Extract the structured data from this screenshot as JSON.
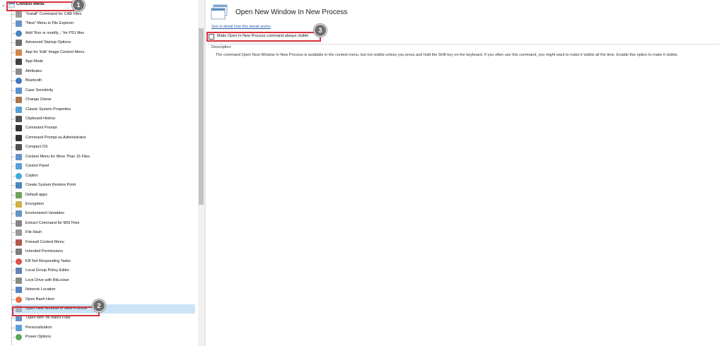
{
  "tree": {
    "root_label": "Context Menu",
    "items": [
      {
        "label": "\"Install\" Command for CAB Files",
        "icon": "cab-file-icon",
        "color": "#8a8a8a"
      },
      {
        "label": "\"New\" Menu in File Explorer",
        "icon": "new-menu-icon",
        "color": "#4a7fbf"
      },
      {
        "label": "Add 'Run or modify...' for PS1 files",
        "icon": "powershell-icon",
        "color": "#2b6cb8"
      },
      {
        "label": "Advanced Startup Options",
        "icon": "startup-icon",
        "color": "#555555"
      },
      {
        "label": "App for 'Edit' Image Context Menu",
        "icon": "paint-icon",
        "color": "#c9742d"
      },
      {
        "label": "App Mode",
        "icon": "app-mode-icon",
        "color": "#222222"
      },
      {
        "label": "Attributes",
        "icon": "attributes-icon",
        "color": "#7a7a7a"
      },
      {
        "label": "Bluetooth",
        "icon": "bluetooth-icon",
        "color": "#1f5fb5"
      },
      {
        "label": "Case Sensitivity",
        "icon": "case-sensitivity-icon",
        "color": "#3d7cc9"
      },
      {
        "label": "Change Owner",
        "icon": "owner-icon",
        "color": "#a05a2c"
      },
      {
        "label": "Classic System Properties",
        "icon": "system-properties-icon",
        "color": "#3a8fd0"
      },
      {
        "label": "Clipboard History",
        "icon": "clipboard-icon",
        "color": "#333333"
      },
      {
        "label": "Command Prompt",
        "icon": "command-prompt-icon",
        "color": "#111111"
      },
      {
        "label": "Command Prompt as Administrator",
        "icon": "admin-prompt-icon",
        "color": "#111111"
      },
      {
        "label": "Compact OS",
        "icon": "compact-os-icon",
        "color": "#333333"
      },
      {
        "label": "Context Menu for More Than 15 Files",
        "icon": "context-menu-icon",
        "color": "#4a7fbf"
      },
      {
        "label": "Control Panel",
        "icon": "control-panel-icon",
        "color": "#3f8dd6"
      },
      {
        "label": "Copilot",
        "icon": "copilot-icon",
        "color": "#1d9bd8"
      },
      {
        "label": "Create System Restore Point",
        "icon": "restore-point-icon",
        "color": "#2f6db5"
      },
      {
        "label": "Default apps",
        "icon": "default-apps-icon",
        "color": "#5a8f3c"
      },
      {
        "label": "Encryption",
        "icon": "lock-icon",
        "color": "#c9a227"
      },
      {
        "label": "Environment Variables",
        "icon": "environment-icon",
        "color": "#4d7fb8"
      },
      {
        "label": "Extract Command for MSI Files",
        "icon": "msi-file-icon",
        "color": "#6f6f6f"
      },
      {
        "label": "File Hash",
        "icon": "file-hash-icon",
        "color": "#888888"
      },
      {
        "label": "Firewall Context Menu",
        "icon": "firewall-icon",
        "color": "#a83a2a"
      },
      {
        "label": "Inherited Permissions",
        "icon": "permissions-icon",
        "color": "#666666"
      },
      {
        "label": "Kill Not Responding Tasks",
        "icon": "kill-task-icon",
        "color": "#d6332c"
      },
      {
        "label": "Local Group Policy Editor",
        "icon": "group-policy-icon",
        "color": "#4a6fa8"
      },
      {
        "label": "Lock Drive with BitLocker",
        "icon": "bitlocker-icon",
        "color": "#777777"
      },
      {
        "label": "Network Location",
        "icon": "network-icon",
        "color": "#3b6fb6"
      },
      {
        "label": "Open Bash Here",
        "icon": "ubuntu-icon",
        "color": "#e95420"
      },
      {
        "label": "Open New Window In New Process",
        "icon": "new-window-icon",
        "color": "#9aa4b0",
        "selected": true
      },
      {
        "label": "'Open with' for Batch Files",
        "icon": "batch-file-icon",
        "color": "#4a7fbf"
      },
      {
        "label": "Personalization",
        "icon": "personalization-icon",
        "color": "#3f8dd6"
      },
      {
        "label": "Power Options",
        "icon": "power-icon",
        "color": "#3c9a3c"
      }
    ]
  },
  "detail": {
    "title": "Open New Window In New Process",
    "see_detail_link": "See in detail how this tweak works",
    "checkbox_label": "Make Open In New Process command always visible",
    "checkbox_checked": false,
    "description_header": "Description",
    "description_text": "The command Open New Window In New Process is available in the context menu, but not visible unless you press and hold the Shift key on the keyboard. If you often use this command, you might want to make it visible all the time. Enable this option to make it visible."
  },
  "badges": {
    "one": "1",
    "two": "2",
    "three": "3"
  },
  "accent_colors": {
    "highlight": "#d6323c",
    "selection": "#cce4f7",
    "link": "#2a5fb0"
  }
}
